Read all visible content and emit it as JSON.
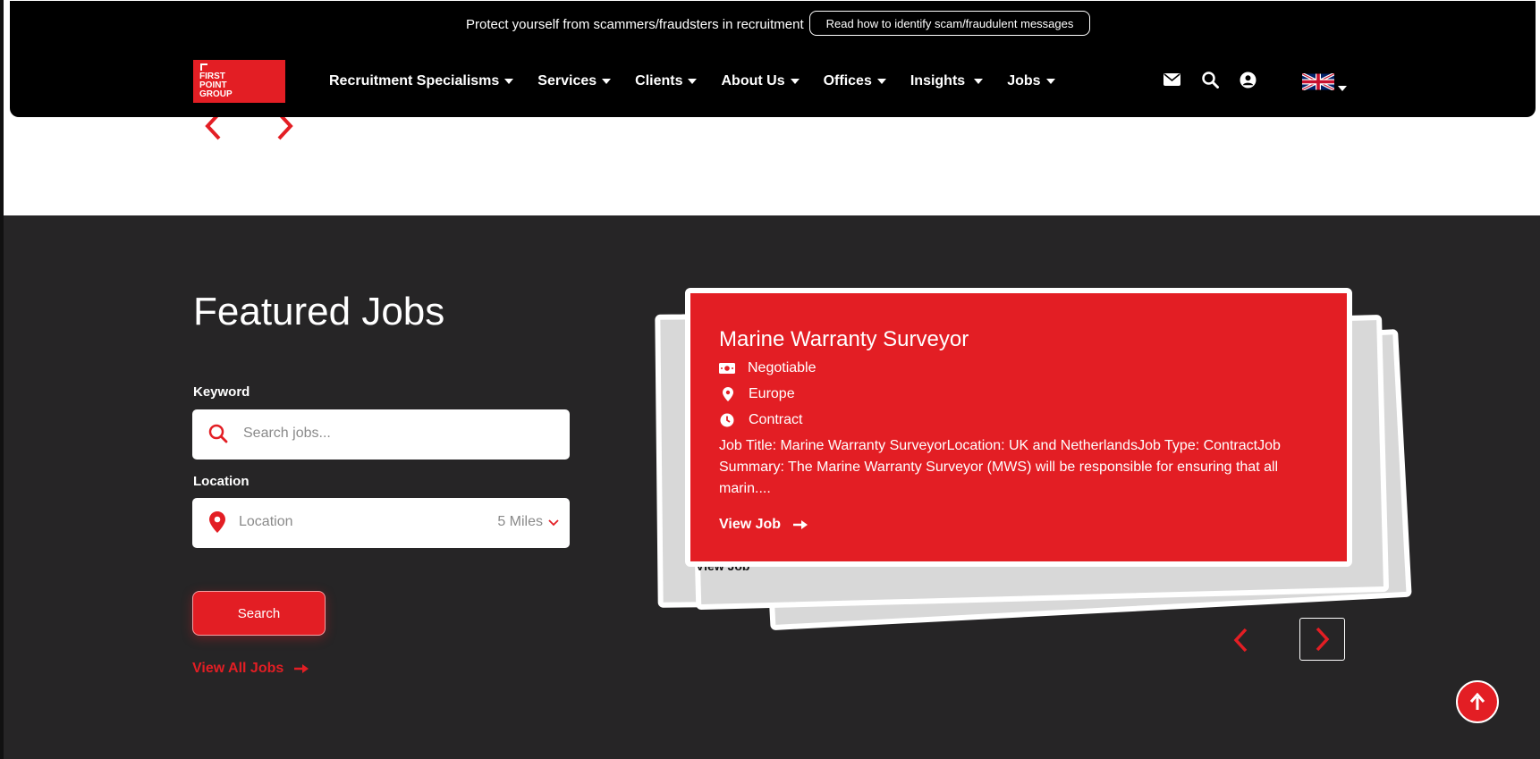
{
  "header": {
    "notice_text": "Protect yourself from scammers/fraudsters in recruitment",
    "notice_button": "Read how to identify scam/fraudulent messages",
    "logo_text": "FIRST POINT GROUP",
    "nav": [
      {
        "label": "Recruitment Specialisms"
      },
      {
        "label": "Services"
      },
      {
        "label": "Clients"
      },
      {
        "label": "About Us"
      },
      {
        "label": "Offices"
      },
      {
        "label": "Insights"
      },
      {
        "label": "Jobs"
      }
    ],
    "icons": [
      "envelope-icon",
      "search-icon",
      "user-icon",
      "uk-flag-icon"
    ]
  },
  "featured": {
    "title": "Featured Jobs",
    "keyword_label": "Keyword",
    "keyword_placeholder": "Search jobs...",
    "location_label": "Location",
    "location_placeholder": "Location",
    "radius_value": "5 Miles",
    "search_button": "Search",
    "view_all": "View All Jobs"
  },
  "job_card": {
    "title": "Marine Warranty Surveyor",
    "salary": "Negotiable",
    "location": "Europe",
    "type": "Contract",
    "description": "Job Title: Marine Warranty SurveyorLocation: UK and NetherlandsJob Type: ContractJob Summary: The Marine Warranty Surveyor (MWS) will be responsible for ensuring that all marin....",
    "view_job": "View Job",
    "back_card_view_job": "View Job"
  },
  "colors": {
    "brand_red": "#e31e24",
    "dark_bg": "#262526",
    "header_bg": "#000000"
  }
}
